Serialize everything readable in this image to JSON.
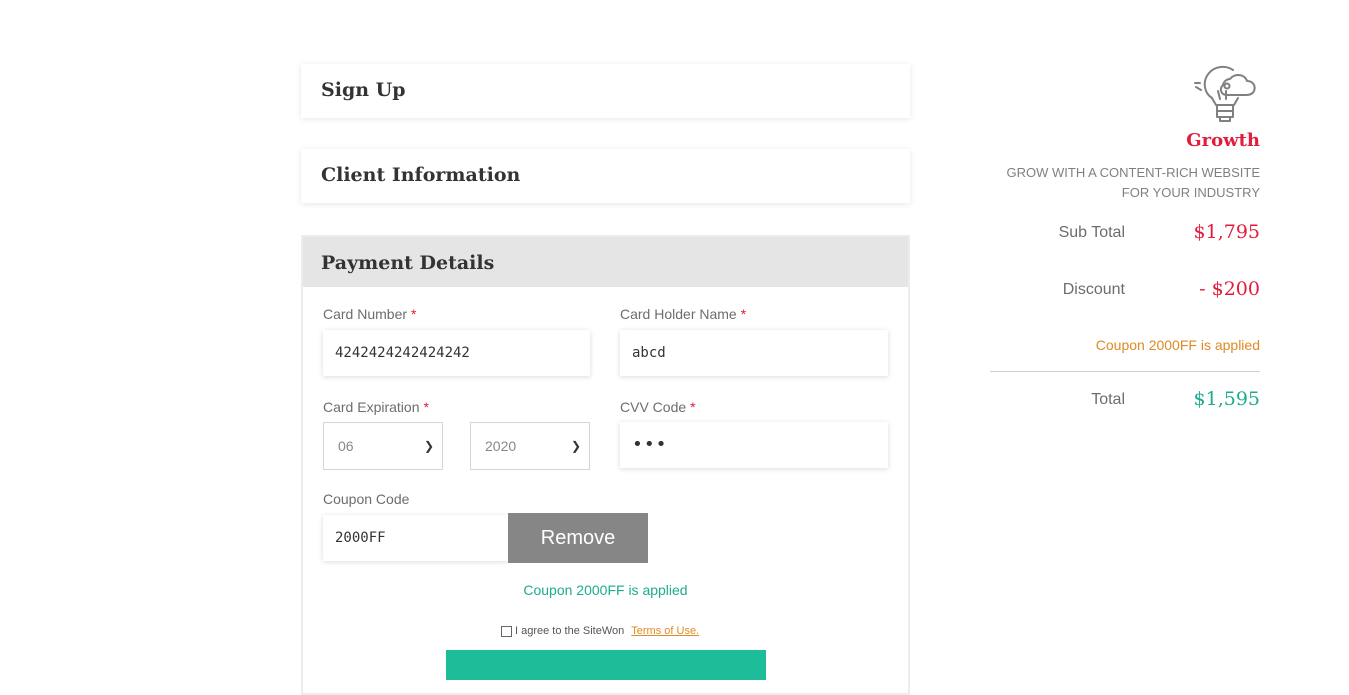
{
  "sections": {
    "signup_title": "Sign Up",
    "client_title": "Client Information",
    "payment_title": "Payment Details"
  },
  "payment": {
    "card_number_label": "Card Number",
    "card_number_value": "4242424242424242",
    "card_holder_label": "Card Holder Name",
    "card_holder_value": "abcd",
    "expiration_label": "Card Expiration",
    "exp_month": "06",
    "exp_year": "2020",
    "cvv_label": "CVV Code",
    "cvv_value": "•••",
    "coupon_label": "Coupon Code",
    "coupon_value": "2000FF",
    "remove_label": "Remove",
    "applied_message": "Coupon 2000FF is applied",
    "agree_text": "I agree to the SiteWon",
    "terms_text": "Terms of Use.",
    "required_mark": "*"
  },
  "plan": {
    "icon": "lightbulb-cloud-icon",
    "name": "Growth",
    "description": "GROW WITH A CONTENT-RICH WEBSITE FOR YOUR INDUSTRY"
  },
  "summary": {
    "subtotal_label": "Sub Total",
    "subtotal_value": "$1,795",
    "discount_label": "Discount",
    "discount_value": "- $200",
    "coupon_note": "Coupon 2000FF is applied",
    "total_label": "Total",
    "total_value": "$1,595"
  },
  "colors": {
    "accent_red": "#e31b3c",
    "accent_green": "#1eac8c",
    "accent_orange": "#e08a23",
    "submit_button": "#1ebd99",
    "remove_button": "#868686"
  }
}
